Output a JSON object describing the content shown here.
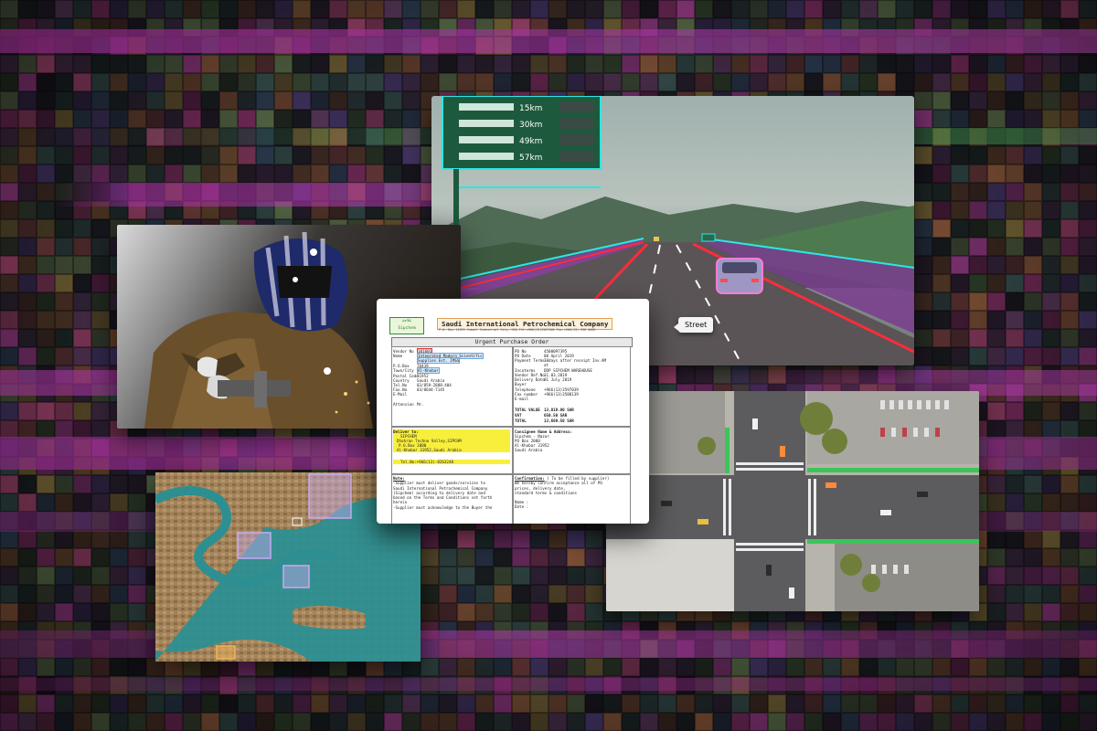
{
  "mosaic_palette": [
    "#3b2a44",
    "#5c3a5e",
    "#1f2b2a",
    "#6b4a2f",
    "#2c3d52",
    "#7a2d5f",
    "#44553b",
    "#8e5a3c",
    "#2a2230",
    "#5b6e4a",
    "#a0446e",
    "#324a48",
    "#6e3c3c",
    "#46386a",
    "#1c1c24",
    "#7d6b3a",
    "#38504e",
    "#9a3d8a",
    "#2e3f2a",
    "#573b2b"
  ],
  "highway": {
    "sign_distances": [
      "15km",
      "30km",
      "49km",
      "57km"
    ],
    "tooltip": "Street"
  },
  "purchase_order": {
    "logo_line1": "علاجة",
    "logo_line2": "Sipchem",
    "company": "Saudi International Petrochemical Company",
    "address_line": "P.O. Box 11923 Jubail Industrial City, KSA  Tel:+966(13)3567400 Fax:+966(13)-358 0666",
    "title": "Urgent Purchase Order",
    "vendor": {
      "vendor_no_label": "Vendor No",
      "vendor_no": "101601",
      "name_label": "Name",
      "name_value": "Integrated Modern Scientific",
      "name_value2": "Supplies Est. IMSS",
      "pobox_label": "P.O.Box",
      "pobox": "70439",
      "town_label": "Town/City",
      "town": "Al-Khobar",
      "postal_label": "Postal Code",
      "postal": "31952",
      "country_label": "Country",
      "country": "Saudi Arabia",
      "tel_label": "Tel.No",
      "tel": "03/859-2888-404",
      "fax_label": "Fax.No",
      "fax": "03/8644-7145",
      "email_label": "E-Mail",
      "attention_label": "Attension",
      "attention": "Mr."
    },
    "order": {
      "po_no_label": "PO No",
      "po_no": "4500097395",
      "po_date_label": "PO Date",
      "po_date": "08 April 2019",
      "payment_label": "Payment Terms",
      "payment": "30days after receipt Inv.AM",
      "payment2": "at",
      "incoterms_label": "Incoterms",
      "incoterms": "DDP SIPCHEM WAREHOUSE",
      "vendor_ref_label": "Vendor Ref.No",
      "vendor_ref": "31.03.2019",
      "delivery_label": "Delivery Date",
      "delivery": "01 July 2019",
      "buyer_label": "Buyer",
      "telephone_label": "Telephone",
      "telephone": "+966(13)3597039",
      "fax_number_label": "Fax number",
      "fax_number": "+966(13)3588139",
      "email_label": "E-mail",
      "total_value_label": "TOTAL VALUE",
      "total_value": "13,019.00   SAR",
      "vat_label": "VAT",
      "vat": "650.50    SAR",
      "total_label": "TOTAL",
      "total": "13,669.50   SAR"
    },
    "deliver_to": {
      "heading": "Deliver to:",
      "line1": "SIPCHEM",
      "line2": "Dhahran Techno Valley,SIPCHM",
      "line3": "P.O.Box 2080",
      "line4": "Al-Khobar 31952,Saudi Arabia",
      "tel": "Tel.No:+966(13)-8263248"
    },
    "consignee": {
      "heading": "Consignee Name & Address:",
      "line1": "Sipchem - Nazar",
      "line2": "PO Box 2080",
      "line3": "Al-Khobar 31952",
      "line4": "Saudi Arabia"
    },
    "note": {
      "heading": "Note:",
      "line1": "-Supplier must deliver goods/services to",
      "line2": "Saudi International Petrochemical Company",
      "line3": "(Sipchem) according to delivery date and",
      "line4": "based on the Terms and Conditions set forth",
      "line5": "herein",
      "line6": "-Supplier must acknowledge to the Buyer the"
    },
    "confirmation": {
      "heading": "Confirmation:",
      "heading_rest": " ( To be filled by supplier)",
      "line1": "We hereby confirm acceptance all of PO",
      "line2": "prices, delivery date,",
      "line3": "standard terms & conditions",
      "name_label": "Name",
      "date_label": "Date"
    }
  }
}
